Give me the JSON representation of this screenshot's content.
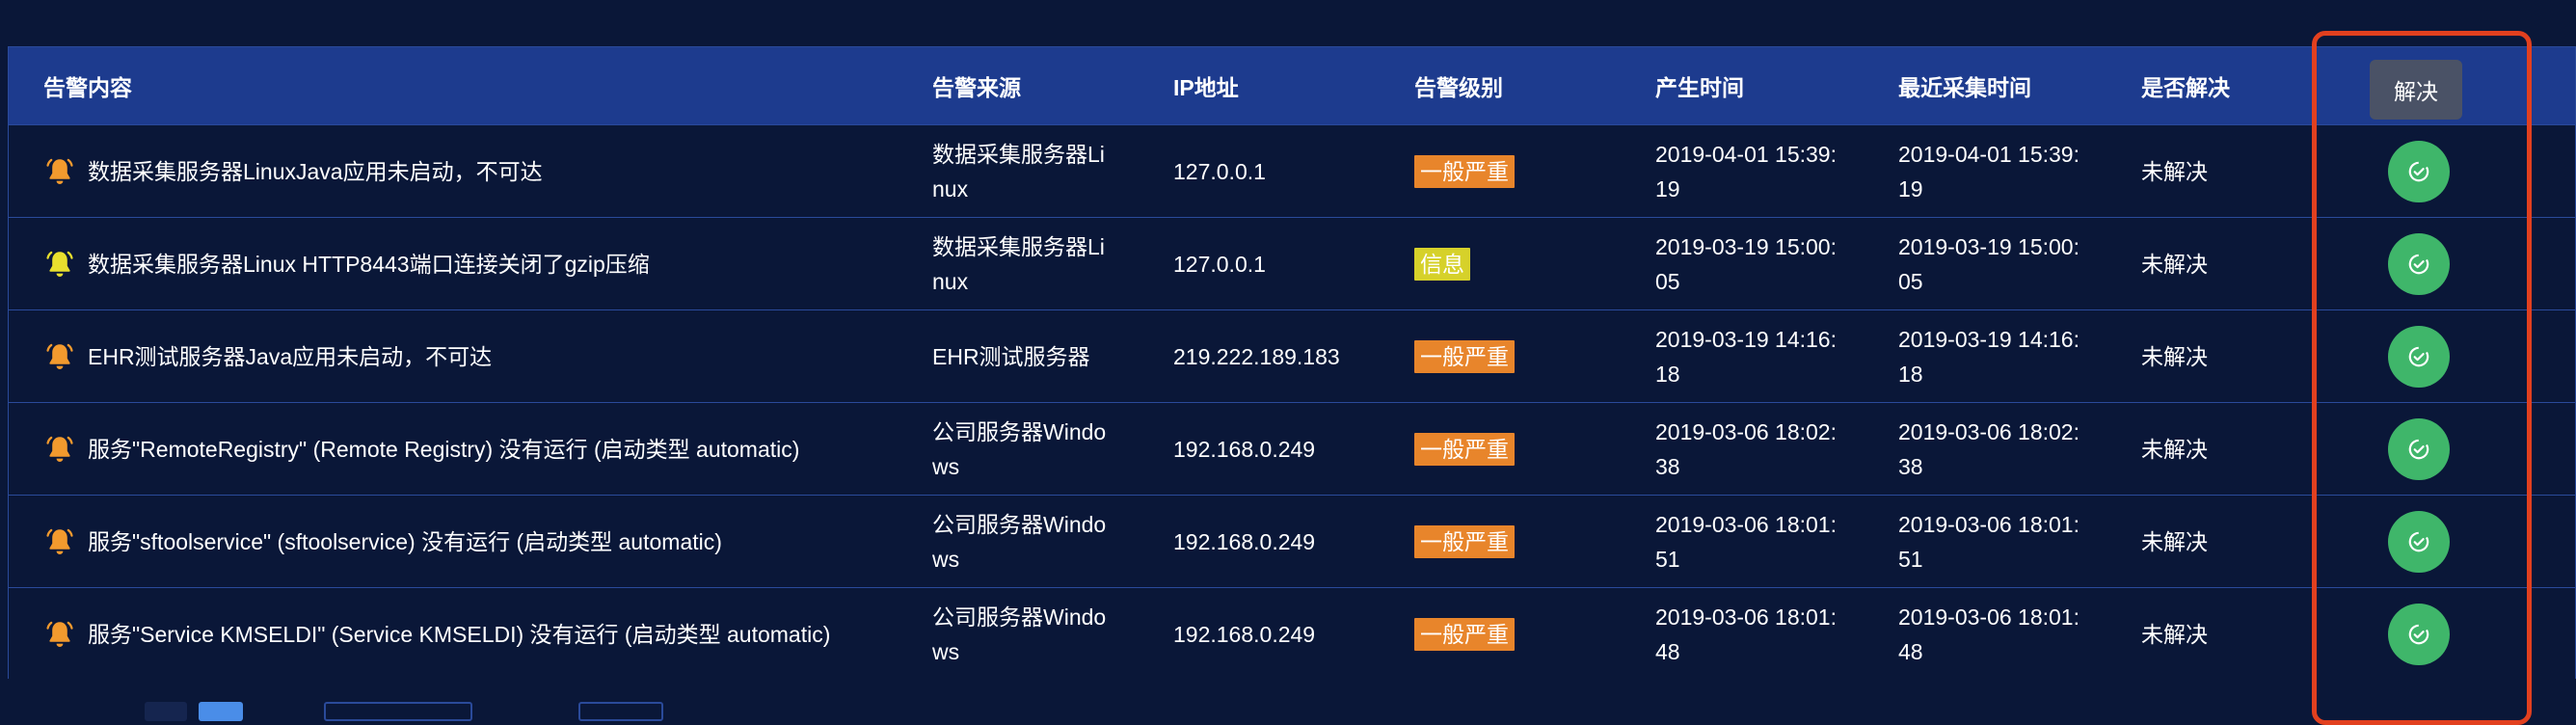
{
  "table": {
    "headers": {
      "content": "告警内容",
      "source": "告警来源",
      "ip": "IP地址",
      "level": "告警级别",
      "created": "产生时间",
      "latest": "最近采集时间",
      "resolved": "是否解决"
    },
    "rows": [
      {
        "content": "数据采集服务器LinuxJava应用未启动，不可达",
        "source": "数据采集服务器Linux",
        "ip": "127.0.0.1",
        "level": "一般严重",
        "level_color": "#e8852b",
        "bell_color": "#f29a2e",
        "created": "2019-04-01 15:39:19",
        "latest": "2019-04-01 15:39:19",
        "resolved": "未解决"
      },
      {
        "content": "数据采集服务器Linux HTTP8443端口连接关闭了gzip压缩",
        "source": "数据采集服务器Linux",
        "ip": "127.0.0.1",
        "level": "信息",
        "level_color": "#d6d12a",
        "bell_color": "#e8df2e",
        "created": "2019-03-19 15:00:05",
        "latest": "2019-03-19 15:00:05",
        "resolved": "未解决"
      },
      {
        "content": "EHR测试服务器Java应用未启动，不可达",
        "source": "EHR测试服务器",
        "ip": "219.222.189.183",
        "level": "一般严重",
        "level_color": "#e8852b",
        "bell_color": "#f29a2e",
        "created": "2019-03-19 14:16:18",
        "latest": "2019-03-19 14:16:18",
        "resolved": "未解决"
      },
      {
        "content": "服务\"RemoteRegistry\" (Remote Registry) 没有运行 (启动类型 automatic)",
        "source": "公司服务器Windows",
        "ip": "192.168.0.249",
        "level": "一般严重",
        "level_color": "#e8852b",
        "bell_color": "#f29a2e",
        "created": "2019-03-06 18:02:38",
        "latest": "2019-03-06 18:02:38",
        "resolved": "未解决"
      },
      {
        "content": "服务\"sftoolservice\" (sftoolservice) 没有运行 (启动类型 automatic)",
        "source": "公司服务器Windows",
        "ip": "192.168.0.249",
        "level": "一般严重",
        "level_color": "#e8852b",
        "bell_color": "#f29a2e",
        "created": "2019-03-06 18:01:51",
        "latest": "2019-03-06 18:01:51",
        "resolved": "未解决"
      },
      {
        "content": "服务\"Service KMSELDI\" (Service KMSELDI) 没有运行 (启动类型 automatic)",
        "source": "公司服务器Windows",
        "ip": "192.168.0.249",
        "level": "一般严重",
        "level_color": "#e8852b",
        "bell_color": "#f29a2e",
        "created": "2019-03-06 18:01:48",
        "latest": "2019-03-06 18:01:48",
        "resolved": "未解决"
      }
    ]
  },
  "tooltip": {
    "text": "解决"
  },
  "colors": {
    "background": "#0a1738",
    "header": "#1d3b8e",
    "resolve_button": "#3fb66a",
    "highlight": "#e2401f"
  },
  "icons": {
    "alert": "bell-icon",
    "resolve": "check-circle-icon"
  }
}
